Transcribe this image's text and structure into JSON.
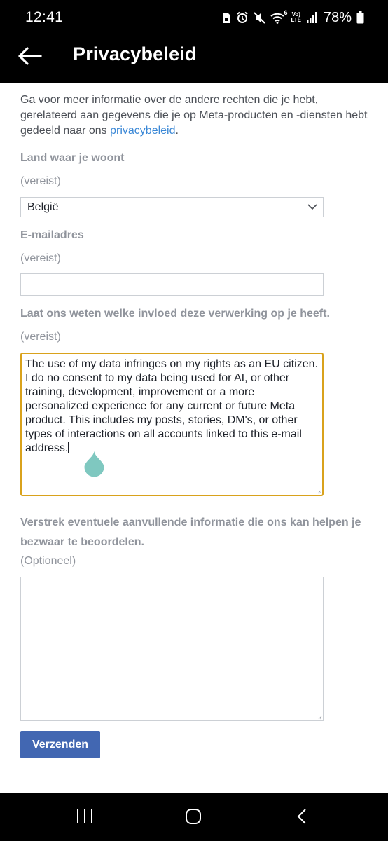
{
  "status_bar": {
    "time": "12:41",
    "signal_text_top": "Vo)",
    "signal_text_bottom": "LTE",
    "wifi_badge": "6",
    "battery_percent": "78%"
  },
  "header": {
    "title": "Privacybeleid"
  },
  "intro": {
    "text": "Ga voor meer informatie over de andere rechten die je hebt, gerelateerd aan gegevens die je op Meta-producten en -diensten hebt gedeeld naar ons ",
    "link_text": "privacybeleid",
    "suffix": "."
  },
  "form": {
    "country": {
      "label": "Land waar je woont",
      "note": "(vereist)",
      "value": "België"
    },
    "email": {
      "label": "E-mailadres",
      "note": "(vereist)",
      "value": ""
    },
    "impact": {
      "label": "Laat ons weten welke invloed deze verwerking op je heeft.",
      "note": "(vereist)",
      "value": "The use of my data infringes on my rights as an EU citizen. I do no consent to my data being used for AI, or other training, development, improvement or a more personalized experience for any current or future Meta product. This includes my posts, stories, DM's, or other types of interactions on all accounts linked to this e-mail address."
    },
    "extra": {
      "label": "Verstrek eventuele aanvullende informatie die ons kan helpen je bezwaar te beoordelen.",
      "note": "(Optioneel)",
      "value": ""
    },
    "submit_label": "Verzenden"
  },
  "colors": {
    "link": "#3b88d6",
    "active_border": "#d9a21c",
    "submit_bg": "#4267b2",
    "caret_handle": "#7fc8c0"
  }
}
